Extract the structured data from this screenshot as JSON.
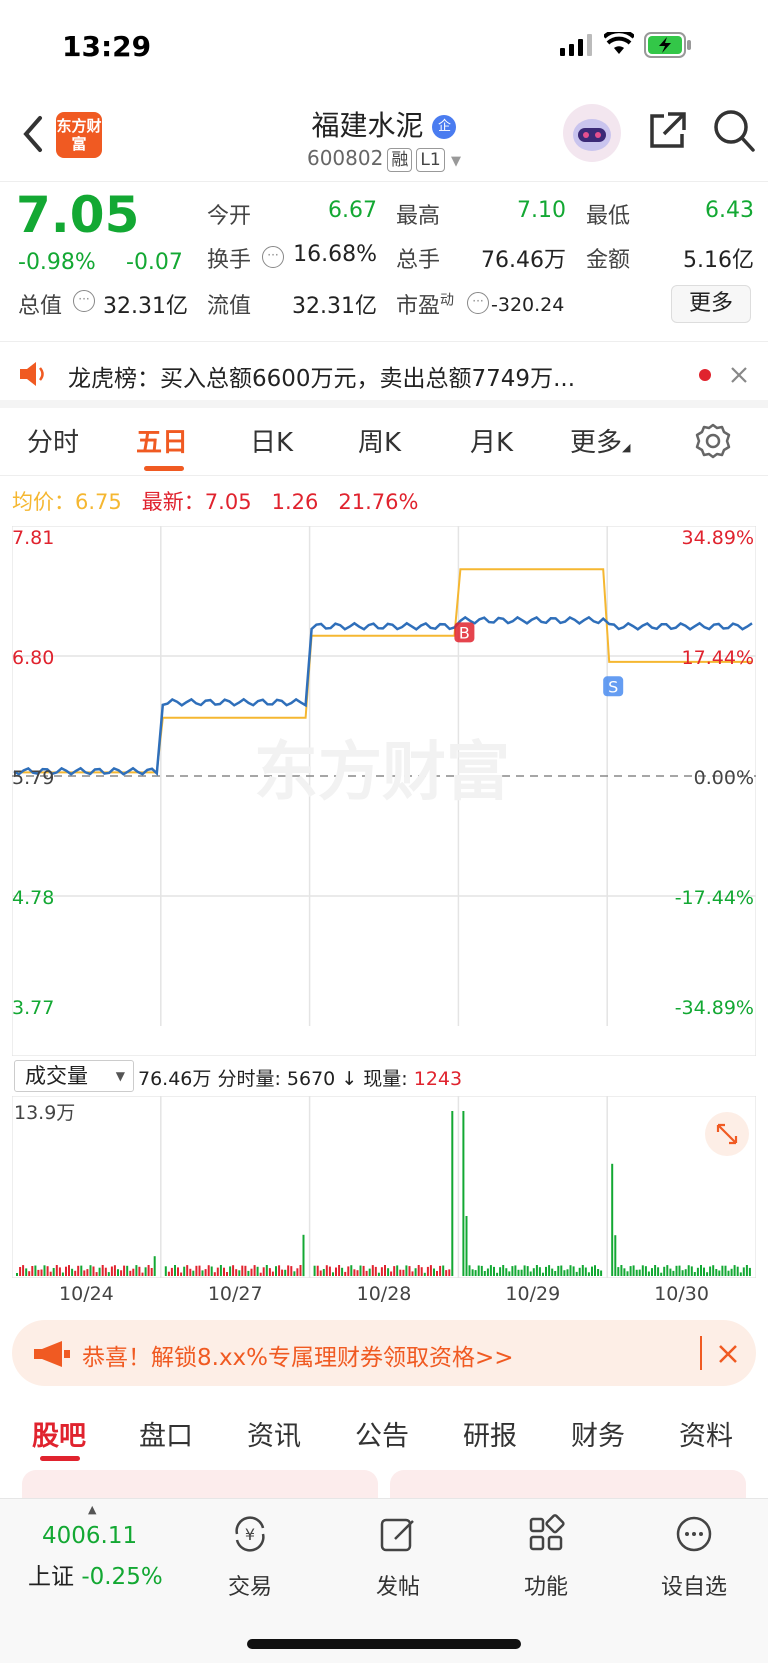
{
  "status": {
    "time": "13:29"
  },
  "header": {
    "logo": "东方财富",
    "title": "福建水泥",
    "title_badge": "企",
    "code": "600802",
    "tag_margin": "融",
    "tag_level": "L1"
  },
  "quote": {
    "price": "7.05",
    "change_pct": "-0.98%",
    "change_abs": "-0.07",
    "open_label": "今开",
    "open": "6.67",
    "high_label": "最高",
    "high": "7.10",
    "low_label": "最低",
    "low": "6.43",
    "turnover_label": "换手",
    "turnover": "16.68%",
    "volume_label": "总手",
    "volume": "76.46万",
    "amount_label": "金额",
    "amount": "5.16亿",
    "mcap_label": "总值",
    "mcap": "32.31亿",
    "float_label": "流值",
    "float": "32.31亿",
    "pe_label": "市盈",
    "pe_sup": "动",
    "pe": "-320.24",
    "more": "更多"
  },
  "notice": {
    "text": "龙虎榜：买入总额6600万元，卖出总额7749万..."
  },
  "chart_tabs": [
    "分时",
    "五日",
    "日K",
    "周K",
    "月K",
    "更多"
  ],
  "legend": {
    "avg_label": "均价：",
    "avg": "6.75",
    "latest_label": "最新：",
    "latest": "7.05",
    "chg": "1.26",
    "pct": "21.76%"
  },
  "volume_bar": {
    "selector": "成交量",
    "total": "76.46万",
    "tick_label": "分时量:",
    "tick": "5670",
    "current_label": "现量:",
    "current": "1243",
    "max_label": "13.9万"
  },
  "promo": {
    "text": "恭喜！解锁8.xx%专属理财券领取资格>>"
  },
  "bottom_tabs": [
    "股吧",
    "盘口",
    "资讯",
    "公告",
    "研报",
    "财务",
    "资料"
  ],
  "footer": {
    "index_value": "4006.11",
    "index_name": "上证",
    "index_change": "-0.25%",
    "items": [
      "交易",
      "发帖",
      "功能",
      "设自选"
    ]
  },
  "colors": {
    "up": "#e0232e",
    "down": "#13a833",
    "accent": "#f05a22",
    "price_line": "#2f6fba",
    "avg_line": "#f5b731"
  },
  "chart_data": {
    "type": "line",
    "x": [
      "10/24",
      "10/27",
      "10/28",
      "10/29",
      "10/30"
    ],
    "y_left_ticks": [
      "7.81",
      "6.80",
      "5.79",
      "4.78",
      "3.77"
    ],
    "y_right_ticks": [
      "34.89%",
      "17.44%",
      "0.00%",
      "-17.44%",
      "-34.89%"
    ],
    "ylim": [
      3.77,
      7.81
    ],
    "watermark": "东方财富",
    "markers": [
      {
        "label": "B",
        "day": "10/29"
      },
      {
        "label": "S",
        "day": "10/30"
      }
    ],
    "series": [
      {
        "name": "最新",
        "day_close": [
          5.83,
          6.41,
          7.05,
          7.1,
          7.05
        ]
      },
      {
        "name": "均价",
        "day_avg": [
          5.82,
          6.28,
          6.97,
          7.53,
          6.75
        ]
      }
    ]
  }
}
